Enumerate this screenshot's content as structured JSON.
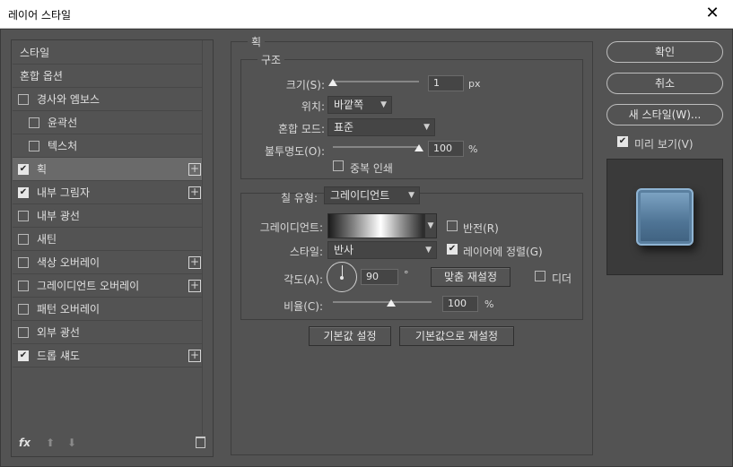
{
  "window": {
    "title": "레이어 스타일",
    "close_glyph": "✕"
  },
  "left_panel": {
    "items": [
      {
        "label": "스타일",
        "checkbox": false,
        "checked": false,
        "plus": false,
        "indent": false,
        "selected": false
      },
      {
        "label": "혼합 옵션",
        "checkbox": false,
        "checked": false,
        "plus": false,
        "indent": false,
        "selected": false
      },
      {
        "label": "경사와 엠보스",
        "checkbox": true,
        "checked": false,
        "plus": false,
        "indent": false,
        "selected": false
      },
      {
        "label": "윤곽선",
        "checkbox": true,
        "checked": false,
        "plus": false,
        "indent": true,
        "selected": false
      },
      {
        "label": "텍스처",
        "checkbox": true,
        "checked": false,
        "plus": false,
        "indent": true,
        "selected": false
      },
      {
        "label": "획",
        "checkbox": true,
        "checked": true,
        "plus": true,
        "indent": false,
        "selected": true
      },
      {
        "label": "내부 그림자",
        "checkbox": true,
        "checked": true,
        "plus": true,
        "indent": false,
        "selected": false
      },
      {
        "label": "내부 광선",
        "checkbox": true,
        "checked": false,
        "plus": false,
        "indent": false,
        "selected": false
      },
      {
        "label": "새틴",
        "checkbox": true,
        "checked": false,
        "plus": false,
        "indent": false,
        "selected": false
      },
      {
        "label": "색상 오버레이",
        "checkbox": true,
        "checked": false,
        "plus": true,
        "indent": false,
        "selected": false
      },
      {
        "label": "그레이디언트 오버레이",
        "checkbox": true,
        "checked": false,
        "plus": true,
        "indent": false,
        "selected": false
      },
      {
        "label": "패턴 오버레이",
        "checkbox": true,
        "checked": false,
        "plus": false,
        "indent": false,
        "selected": false
      },
      {
        "label": "외부 광선",
        "checkbox": true,
        "checked": false,
        "plus": false,
        "indent": false,
        "selected": false
      },
      {
        "label": "드롭 섀도",
        "checkbox": true,
        "checked": true,
        "plus": true,
        "indent": false,
        "selected": false
      }
    ],
    "footer": {
      "fx": "fx",
      "up": "⬆",
      "down": "⬇"
    }
  },
  "stroke": {
    "group_title": "획",
    "structure_title": "구조",
    "size_label": "크기(S):",
    "size_value": "1",
    "size_unit": "px",
    "size_fraction": 0.0,
    "position_label": "위치:",
    "position_value": "바깥쪽",
    "blend_label": "혼합 모드:",
    "blend_value": "표준",
    "opacity_label": "불투명도(O):",
    "opacity_value": "100",
    "opacity_unit": "%",
    "opacity_fraction": 1.0,
    "overprint_label": "중복 인쇄",
    "overprint_checked": false,
    "fill_type_label": "칠 유형:",
    "fill_type_value": "그레이디언트",
    "gradient_label": "그레이디언트:",
    "reverse_label": "반전(R)",
    "reverse_checked": false,
    "style_label": "스타일:",
    "style_value": "반사",
    "align_label": "레이어에 정렬(G)",
    "align_checked": true,
    "angle_label": "각도(A):",
    "angle_value": "90",
    "angle_unit": "°",
    "reset_align_label": "맞춤 재설정",
    "dither_label": "디더",
    "dither_checked": false,
    "scale_label": "비율(C):",
    "scale_value": "100",
    "scale_unit": "%",
    "scale_fraction": 0.5,
    "make_default_label": "기본값 설정",
    "reset_default_label": "기본값으로 재설정"
  },
  "right": {
    "ok_label": "확인",
    "cancel_label": "취소",
    "new_style_label": "새 스타일(W)...",
    "preview_label": "미리 보기(V)",
    "preview_checked": true
  },
  "colors": {
    "panel": "#535353",
    "preview_tile": "#5a7f9f"
  }
}
